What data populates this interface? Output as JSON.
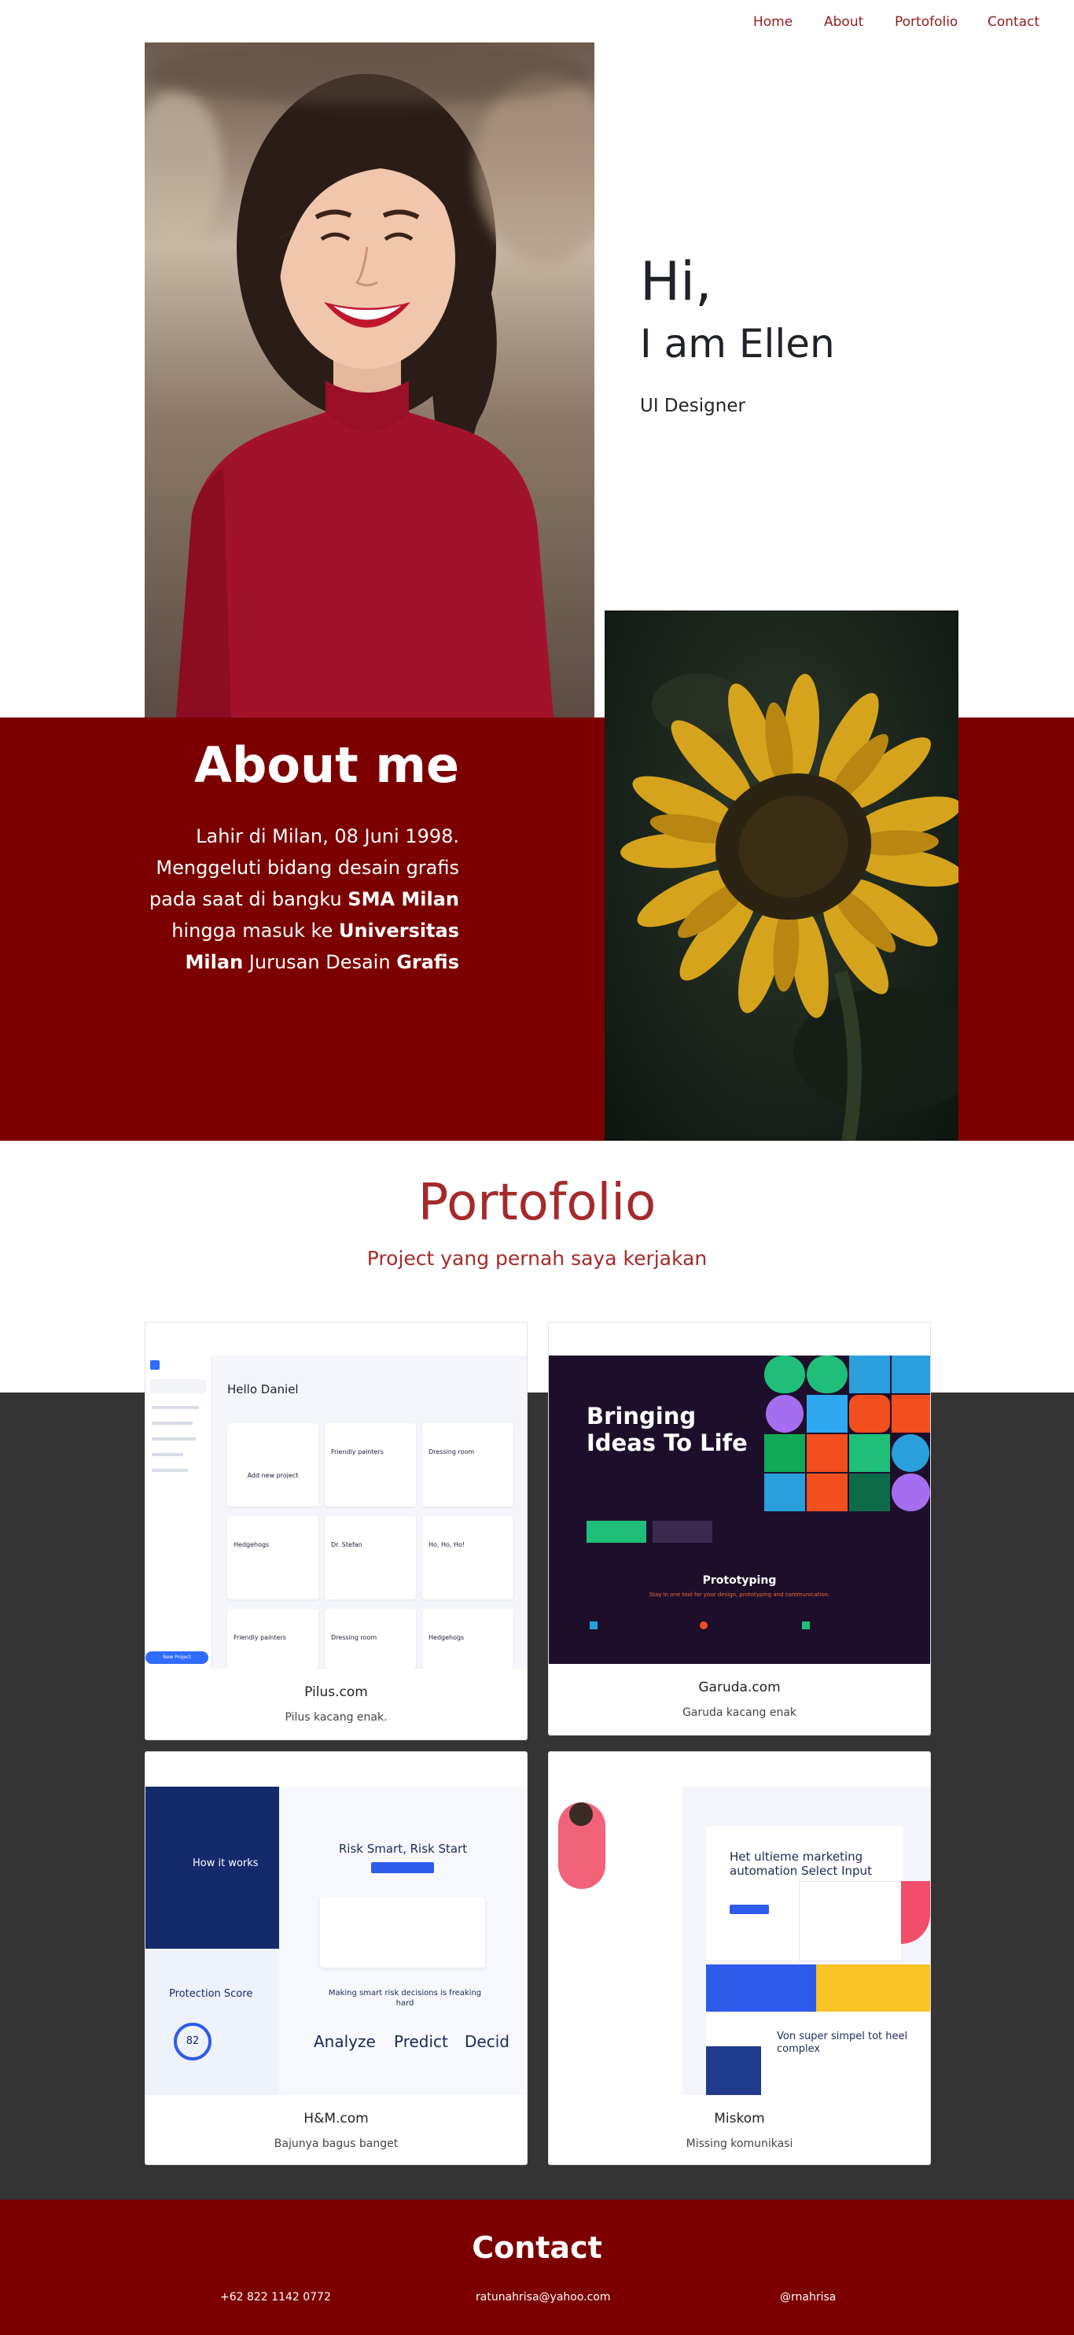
{
  "nav": {
    "items": [
      {
        "label": "Home"
      },
      {
        "label": "About"
      },
      {
        "label": "Portofolio"
      },
      {
        "label": "Contact"
      }
    ]
  },
  "hero": {
    "greeting": "Hi,",
    "name": "I am Ellen",
    "role": "UI Designer"
  },
  "about": {
    "title": "About me",
    "line1": "Lahir di Milan, 08 Juni 1998.",
    "line2": "Menggeluti bidang desain grafis",
    "line3_pre": "pada saat di bangku ",
    "line3_bold": "SMA Milan",
    "line4_pre": "hingga masuk ke ",
    "line4_bold": "Universitas",
    "line5_bold": "Milan",
    "line5_mid": " Jurusan Desain ",
    "line5_bold2": "Grafis"
  },
  "portfolio": {
    "title": "Portofolio",
    "subtitle": "Project yang pernah saya kerjakan",
    "cards": [
      {
        "title": "Pilus.com",
        "desc": "Pilus kacang enak.",
        "thumb": {
          "greeting": "Hello Daniel",
          "add_label": "Add new project",
          "card_names": [
            "Friendly painters",
            "Dressing room",
            "Hedgehogs",
            "Dr. Stefan",
            "Ho, Ho, Ho!",
            "Friendly painters",
            "Dressing room",
            "Hedgehogs"
          ],
          "new_button": "New Project"
        }
      },
      {
        "title": "Garuda.com",
        "desc": "Garuda kacang enak",
        "thumb": {
          "headline1": "Bringing",
          "headline2": "Ideas To Life",
          "section": "Prototyping",
          "tagline": "Stay in one tool for your design, prototyping and communication."
        }
      },
      {
        "title": "H&M.com",
        "desc": "Bajunya bagus banget",
        "thumb": {
          "how": "How it works",
          "hero": "Risk Smart, Risk Start",
          "score": "Protection Score",
          "score_value": "82",
          "making": "Making smart risk decisions is freaking hard",
          "words": [
            "Analyze",
            "Predict",
            "Decid"
          ]
        }
      },
      {
        "title": "Miskom",
        "desc": "Missing komunikasi",
        "thumb": {
          "headline": "Het ultieme marketing automation Select Input",
          "bottom": "Von super simpel tot heel complex"
        }
      }
    ]
  },
  "contact": {
    "title": "Contact",
    "phone": "+62 822 1142 0772",
    "email": "ratunahrisa@yahoo.com",
    "handle": "@rnahrisa"
  },
  "colors": {
    "brand": "#7c0000",
    "accent_text": "#a52a2a",
    "dark_band": "#343434"
  }
}
